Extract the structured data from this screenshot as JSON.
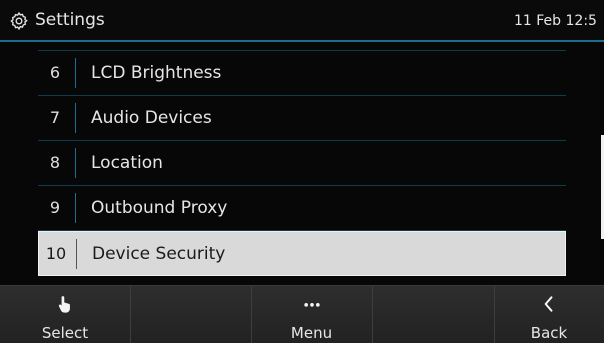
{
  "header": {
    "title": "Settings",
    "icon": "gear-icon",
    "datetime": "11 Feb 12:5"
  },
  "list": {
    "items": [
      {
        "number": "6",
        "label": "LCD Brightness",
        "selected": false
      },
      {
        "number": "7",
        "label": "Audio Devices",
        "selected": false
      },
      {
        "number": "8",
        "label": "Location",
        "selected": false
      },
      {
        "number": "9",
        "label": "Outbound Proxy",
        "selected": false
      },
      {
        "number": "10",
        "label": "Device Security",
        "selected": true
      }
    ]
  },
  "softkeys": {
    "select": {
      "label": "Select",
      "icon": "hand-pointer-icon"
    },
    "menu": {
      "label": "Menu",
      "icon": "more-dots-icon"
    },
    "back": {
      "label": "Back",
      "icon": "chevron-left-icon"
    }
  },
  "colors": {
    "accent": "#1b6e8f",
    "selected_bg": "#d9d9d9",
    "background": "#070707"
  }
}
